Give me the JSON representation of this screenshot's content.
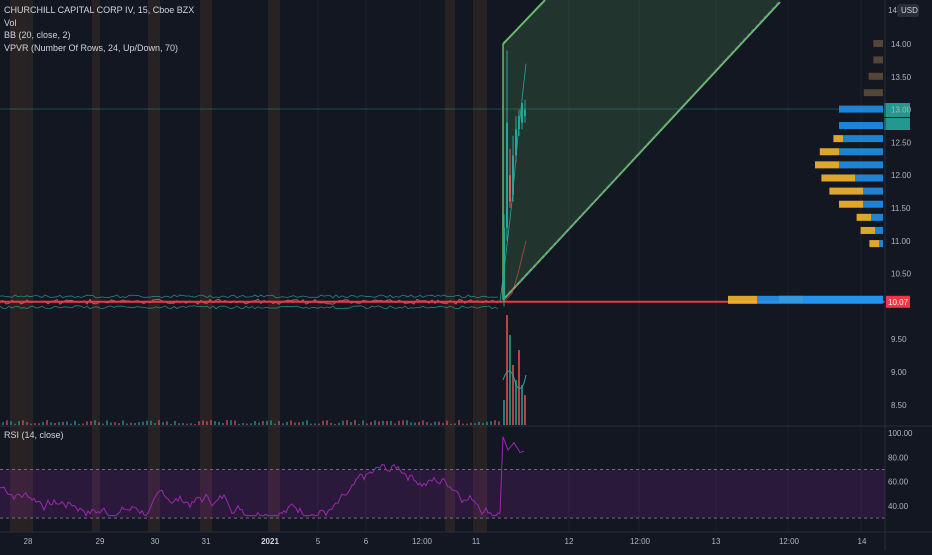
{
  "legend": {
    "symbol_line": "CHURCHILL CAPITAL CORP IV, 15, Cboe BZX",
    "vol_line": "Vol",
    "bb_line": "BB (20, close, 2)",
    "vpvr_line": "VPVR (Number Of Rows, 24, Up/Down, 70)"
  },
  "rsi_title": "RSI (14, close)",
  "price_axis": {
    "currency": "USD",
    "top_label": "14.",
    "ticks": [
      "14.00",
      "13.50",
      "13.00",
      "12.50",
      "12.00",
      "11.50",
      "11.00",
      "10.50",
      "10.07",
      "9.50",
      "9.00",
      "8.50"
    ],
    "current_price": "10.07"
  },
  "rsi_axis": {
    "ticks": [
      "100.00",
      "80.00",
      "60.00",
      "40.00"
    ]
  },
  "time_axis": {
    "ticks": [
      "28",
      "29",
      "30",
      "31",
      "2021",
      "5",
      "6",
      "12:00",
      "11",
      "12",
      "12:00",
      "13",
      "12:00",
      "14"
    ]
  },
  "colors": {
    "background": "#131722",
    "up": "#26a69a",
    "down": "#ef5350",
    "price_line": "#f23645",
    "rsi": "#9c27b0",
    "vpvr_up": "#2196f3",
    "vpvr_down": "#f5b72e",
    "projection": "#66bb6a"
  },
  "chart_data": {
    "type": "candlestick",
    "title": "CHURCHILL CAPITAL CORP IV, 15, Cboe BZX",
    "ylim": [
      8.3,
      14.3
    ],
    "price_before_jump": 10.07,
    "jump_high": 13.9,
    "jump_close": 13.1,
    "horizontal_line": 10.07,
    "rsi": {
      "ylim": [
        20,
        100
      ],
      "overbought": 70,
      "oversold": 30,
      "level_before": 50,
      "level_after": 85
    },
    "vpvr_rows": [
      {
        "price": 14.0,
        "up": 0.0,
        "down": 0.1
      },
      {
        "price": 13.75,
        "up": 0.0,
        "down": 0.1
      },
      {
        "price": 13.5,
        "up": 0.0,
        "down": 0.15
      },
      {
        "price": 13.25,
        "up": 0.0,
        "down": 0.2
      },
      {
        "price": 13.0,
        "up": 0.55,
        "down": 0.0
      },
      {
        "price": 12.75,
        "up": 0.55,
        "down": 0.0
      },
      {
        "price": 12.55,
        "up": 0.5,
        "down": 0.1
      },
      {
        "price": 12.35,
        "up": 0.55,
        "down": 0.2
      },
      {
        "price": 12.15,
        "up": 0.55,
        "down": 0.25
      },
      {
        "price": 11.95,
        "up": 0.35,
        "down": 0.35
      },
      {
        "price": 11.75,
        "up": 0.25,
        "down": 0.35
      },
      {
        "price": 11.55,
        "up": 0.25,
        "down": 0.25
      },
      {
        "price": 11.35,
        "up": 0.15,
        "down": 0.15
      },
      {
        "price": 11.15,
        "up": 0.1,
        "down": 0.15
      },
      {
        "price": 10.95,
        "up": 0.05,
        "down": 0.1
      },
      {
        "price": 10.1,
        "up": 1.0,
        "down": 0.25
      }
    ]
  }
}
